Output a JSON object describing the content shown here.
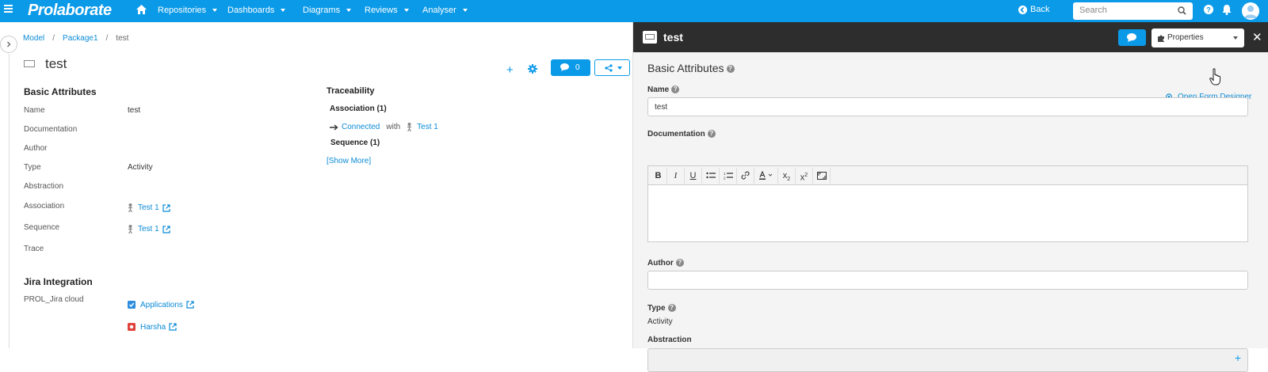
{
  "nav": {
    "brand": "Prolaborate",
    "menus": [
      "Repositories",
      "Dashboards",
      "Diagrams",
      "Reviews",
      "Analyser"
    ],
    "back_label": "Back",
    "search_placeholder": "Search"
  },
  "breadcrumb": [
    "Model",
    "Package1",
    "test"
  ],
  "element": {
    "title": "test",
    "comment_count": "0"
  },
  "basic_attributes": {
    "heading": "Basic Attributes",
    "rows": [
      {
        "key": "Name",
        "value": "test"
      },
      {
        "key": "Documentation",
        "value": ""
      },
      {
        "key": "Author",
        "value": ""
      },
      {
        "key": "Type",
        "value": "Activity"
      },
      {
        "key": "Abstraction",
        "value": ""
      },
      {
        "key": "Association",
        "value": "Test 1"
      },
      {
        "key": "Sequence",
        "value": "Test 1"
      },
      {
        "key": "Trace",
        "value": ""
      }
    ]
  },
  "jira": {
    "heading": "Jira Integration",
    "key": "PROL_Jira cloud",
    "items": [
      {
        "label": "Applications",
        "color": "#2d8ee0"
      },
      {
        "label": "Harsha",
        "color": "#e0413a"
      }
    ]
  },
  "traceability": {
    "heading": "Traceability",
    "association_heading": "Association (1)",
    "connected": "Connected",
    "with": "with",
    "target": "Test 1",
    "sequence_heading": "Sequence (1)",
    "show_more": "[Show More]"
  },
  "panel": {
    "title": "test",
    "view_select": "Properties",
    "section_heading": "Basic Attributes",
    "open_form_designer": "Open Form Designer",
    "fields": {
      "name_label": "Name",
      "name_value": "test",
      "documentation_label": "Documentation",
      "author_label": "Author",
      "author_value": "",
      "type_label": "Type",
      "type_value": "Activity",
      "abstraction_label": "Abstraction"
    },
    "editor_tools": [
      "B",
      "I",
      "U",
      "bullet-list",
      "numbered-list",
      "link",
      "font-color",
      "subscript",
      "superscript",
      "fullscreen"
    ]
  },
  "colors": {
    "primary": "#0b9ae8",
    "panel_header": "#2d2d2d"
  }
}
